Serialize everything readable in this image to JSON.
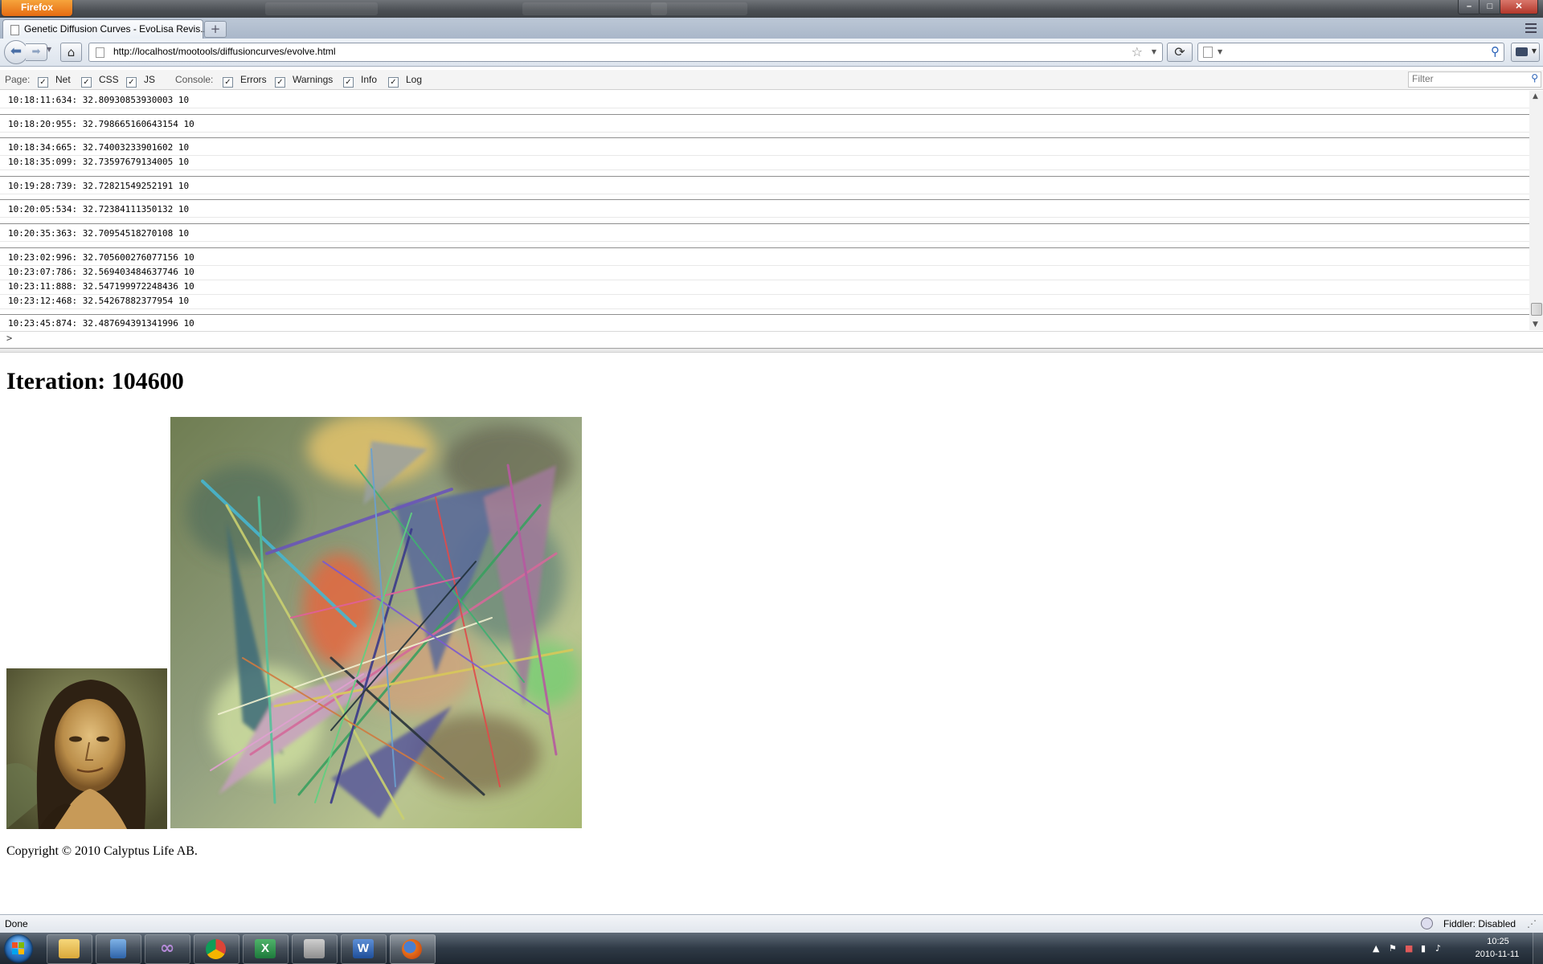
{
  "browser": {
    "app_button_label": "Firefox",
    "tab_title": "Genetic Diffusion Curves - EvoLisa Revis...",
    "new_tab_label": "+",
    "url": "http://localhost/mootools/diffusioncurves/evolve.html",
    "window_controls": {
      "minimize": "–",
      "maximize": "□",
      "close": "✕"
    },
    "icons": {
      "back": "back-arrow-icon",
      "forward": "forward-arrow-icon",
      "home": "home-icon",
      "reload": "reload-icon",
      "bookmark_star": "star-icon",
      "search": "magnifier-icon"
    }
  },
  "firebug": {
    "page_label": "Page:",
    "page_filters": [
      {
        "label": "Net",
        "checked": true
      },
      {
        "label": "CSS",
        "checked": true
      },
      {
        "label": "JS",
        "checked": true
      }
    ],
    "console_label": "Console:",
    "console_filters": [
      {
        "label": "Errors",
        "checked": true
      },
      {
        "label": "Warnings",
        "checked": true
      },
      {
        "label": "Info",
        "checked": true
      },
      {
        "label": "Log",
        "checked": true
      }
    ],
    "filter_placeholder": "Filter",
    "log_lines": [
      "10:18:11:634: 32.80930853930003 10",
      "10:18:20:955: 32.798665160643154 10",
      "10:18:34:665: 32.74003233901602 10",
      "10:18:35:099: 32.73597679134005 10",
      "10:19:28:739: 32.72821549252191 10",
      "10:20:05:534: 32.72384111350132 10",
      "10:20:35:363: 32.70954518270108 10",
      "10:23:02:996: 32.705600276077156 10",
      "10:23:07:786: 32.569403484637746 10",
      "10:23:11:888: 32.547199972248436 10",
      "10:23:12:468: 32.54267882377954 10",
      "10:23:45:874: 32.487694391341996 10"
    ],
    "prompt": ">"
  },
  "page": {
    "iteration_label": "Iteration: 104600",
    "copyright": "Copyright © 2010 Calyptus Life AB."
  },
  "statusbar": {
    "status": "Done",
    "fiddler": "Fiddler: Disabled"
  },
  "taskbar": {
    "apps": [
      "windows-explorer",
      "notes",
      "visual-studio",
      "chrome",
      "excel",
      "tools",
      "word",
      "firefox"
    ],
    "active_app": "firefox",
    "time": "10:25",
    "date": "2010-11-11"
  }
}
